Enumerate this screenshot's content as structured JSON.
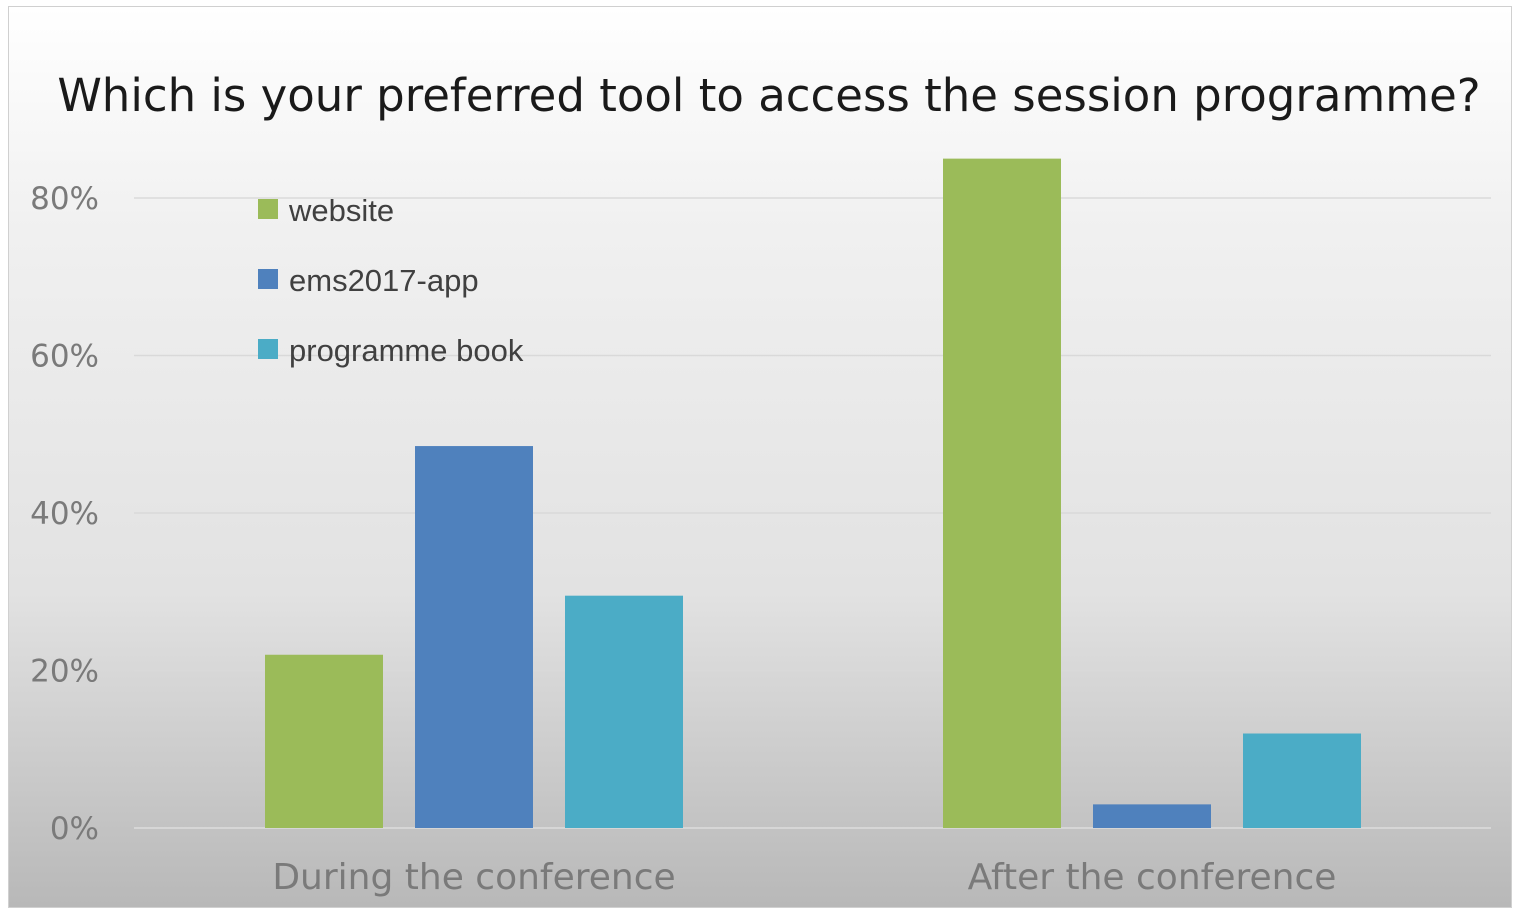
{
  "chart_data": {
    "type": "bar",
    "title": "Which is your preferred tool to access the session programme?",
    "categories": [
      "During the conference",
      "After the conference"
    ],
    "series": [
      {
        "name": "website",
        "color": "#9bbb59",
        "values": [
          22,
          85
        ]
      },
      {
        "name": "ems2017-app",
        "color": "#4f81bd",
        "values": [
          48.5,
          3
        ]
      },
      {
        "name": "programme book",
        "color": "#4bacc6",
        "values": [
          29.5,
          12
        ]
      }
    ],
    "ylim": [
      0,
      80
    ],
    "yticks": [
      0,
      20,
      40,
      60,
      80
    ],
    "ytick_labels": [
      "0%",
      "20%",
      "40%",
      "60%",
      "80%"
    ],
    "grid": true,
    "legend_position": "top-left"
  }
}
